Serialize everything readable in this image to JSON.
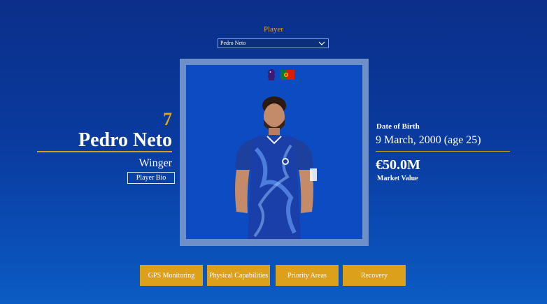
{
  "filter": {
    "label": "Player",
    "selected": "Pedro Neto"
  },
  "player": {
    "number": "7",
    "name": "Pedro Neto",
    "position": "Winger",
    "bio_button": "Player Bio",
    "dob_label": "Date of Birth",
    "dob_value": "9 March, 2000 (age 25)",
    "market_value": "€50.0M",
    "market_value_label": "Market Value"
  },
  "icons": {
    "league": "premier-league-lion-icon",
    "flag": "portugal-flag-icon",
    "dropdown": "chevron-down-icon"
  },
  "nav": {
    "gps": "GPS Monitoring",
    "physical": "Physical Capabilities",
    "priority": "Priority Areas",
    "recovery": "Recovery"
  },
  "colors": {
    "accent": "#dca01b",
    "background": "#0a3a9e",
    "frame": "#6f8fc9",
    "kit": "#1a3fa8"
  }
}
